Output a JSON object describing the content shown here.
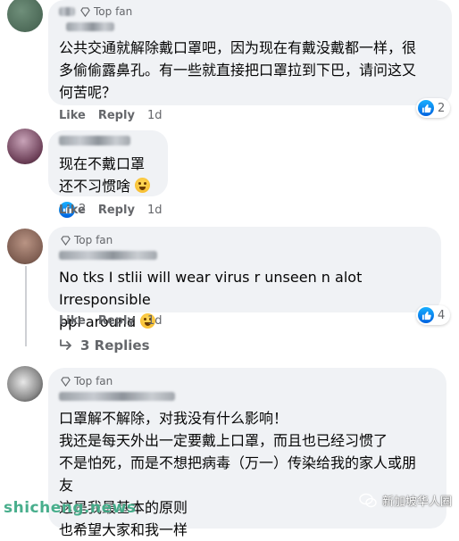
{
  "comments": [
    {
      "badge": "Top fan",
      "text_lines": [
        "公共交通就解除戴口罩吧，因为现在有戴没戴都一样，很",
        "多偷偷露鼻孔。有一些就直接把口罩拉到下巴，请问这又",
        "何苦呢？"
      ],
      "reaction_count": "2",
      "like": "Like",
      "reply": "Reply",
      "time": "1d"
    },
    {
      "text_lines": [
        "现在不戴口罩",
        "还不习惯啥"
      ],
      "reaction_count": "2",
      "like": "Like",
      "reply": "Reply",
      "time": "1d"
    },
    {
      "badge": "Top fan",
      "text_lines": [
        "No tks I stlii will wear virus r unseen n alot Irresponsible",
        "ppl around"
      ],
      "reaction_count": "4",
      "like": "Like",
      "reply": "Reply",
      "time": "1d",
      "replies_label": "3 Replies"
    },
    {
      "badge": "Top fan",
      "text_lines": [
        "口罩解不解除，对我没有什么影响！",
        "我还是每天外出一定要戴上口罩，而且也已经习惯了",
        "不是怕死，而是不想把病毒（万一）传染给我的家人或朋",
        "友",
        "这是我最基本的原则",
        "也希望大家和我一样"
      ]
    }
  ],
  "watermark": {
    "left": "shicheng.news",
    "right": "新加坡华人圈"
  }
}
